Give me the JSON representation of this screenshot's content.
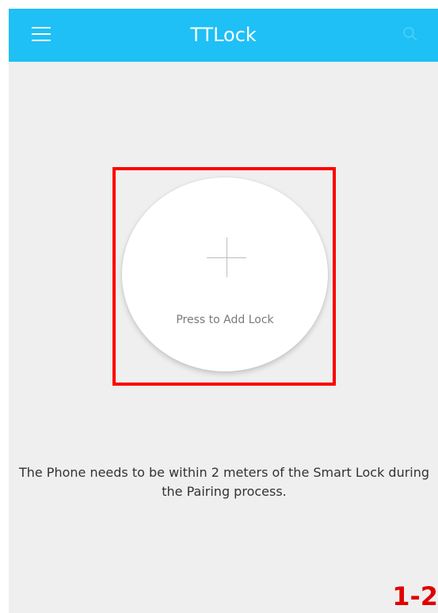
{
  "app": {
    "title": "TTLock"
  },
  "toolbar": {
    "menu_icon": "hamburger-menu-icon",
    "search_icon": "search-icon"
  },
  "add_lock": {
    "label": "Press to Add Lock",
    "icon": "plus-icon"
  },
  "notice": {
    "text": "The Phone needs to be within 2 meters of the Smart Lock during the Pairing process."
  },
  "page_marker": {
    "text": "1-2"
  },
  "colors": {
    "appbar": "#1ec0f5",
    "background": "#efefef",
    "highlight": "#ff0000",
    "marker": "#e00000"
  }
}
